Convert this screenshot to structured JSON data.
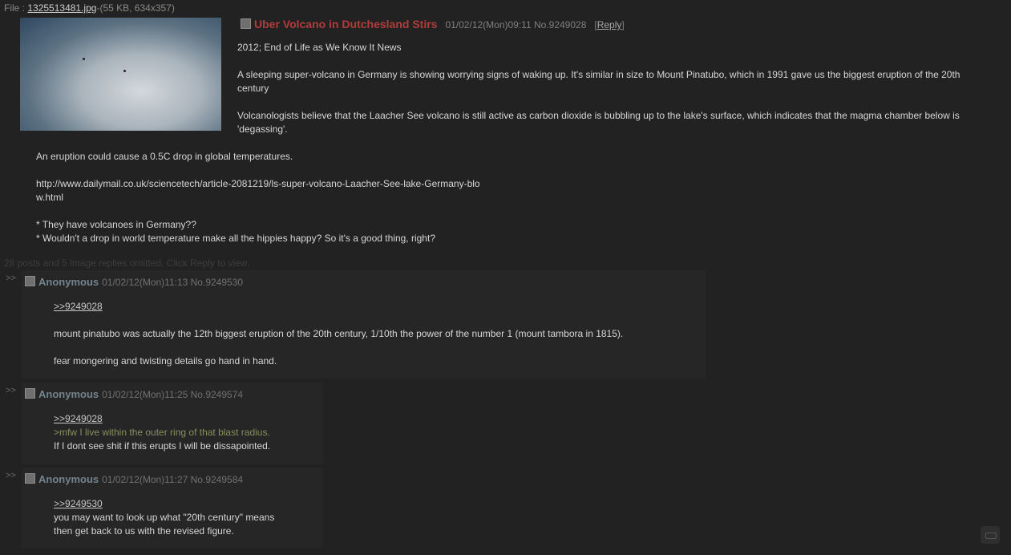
{
  "file": {
    "label": "File :",
    "name": "1325513481.jpg",
    "info": "-(55 KB, 634x357)"
  },
  "op": {
    "subject": "Uber Volcano in Dutchesland Stirs",
    "meta": "01/02/12(Mon)09:11 No.9249028",
    "reply": "Reply",
    "body": [
      "2012; End of Life as We Know It News",
      "A sleeping super-volcano in Germany is showing worrying signs of waking up. It's similar in size to Mount Pinatubo, which in 1991 gave us the biggest eruption of the 20th century",
      "Volcanologists believe that the Laacher See volcano is still active as carbon dioxide is bubbling up to the lake's surface, which indicates that the magma chamber below is 'degassing'."
    ],
    "cont": {
      "line1": "An eruption could cause a 0.5C drop in global temperatures.",
      "url1": "http://www.dailymail.co.uk/sciencetech/article-2081219/ls-super-volcano-Laacher-See-lake-Germany-blo",
      "url2": "w.html",
      "q1": "* They have volcanoes in Germany??",
      "q2": "* Wouldn't a drop in world temperature make all the hippies happy? So it's a good thing, right?"
    }
  },
  "omitted": "28 posts and 5 image replies omitted. Click Reply to view.",
  "replies": [
    {
      "arrows": ">>",
      "name": "Anonymous",
      "meta": "01/02/12(Mon)11:13 No.9249530",
      "quote": ">>9249028",
      "line1": "mount pinatubo was actually the 12th biggest eruption of the 20th century, 1/10th the power of the number 1 (mount tambora in 1815).",
      "line2": "fear mongering and twisting details go hand in hand."
    },
    {
      "arrows": ">>",
      "name": "Anonymous",
      "meta": "01/02/12(Mon)11:25 No.9249574",
      "quote": ">>9249028",
      "greentext": ">mfw I live within the outer ring of that blast radius.",
      "line1": "If I dont see shit if this erupts I will be dissapointed."
    },
    {
      "arrows": ">>",
      "name": "Anonymous",
      "meta": "01/02/12(Mon)11:27 No.9249584",
      "quote": ">>9249530",
      "line1": "you may want to look up what \"20th century\" means",
      "line2": "then get back to us with the revised figure."
    }
  ],
  "icons": {
    "checkbox": "checkbox-icon",
    "scroll": "scroll-top-icon"
  }
}
